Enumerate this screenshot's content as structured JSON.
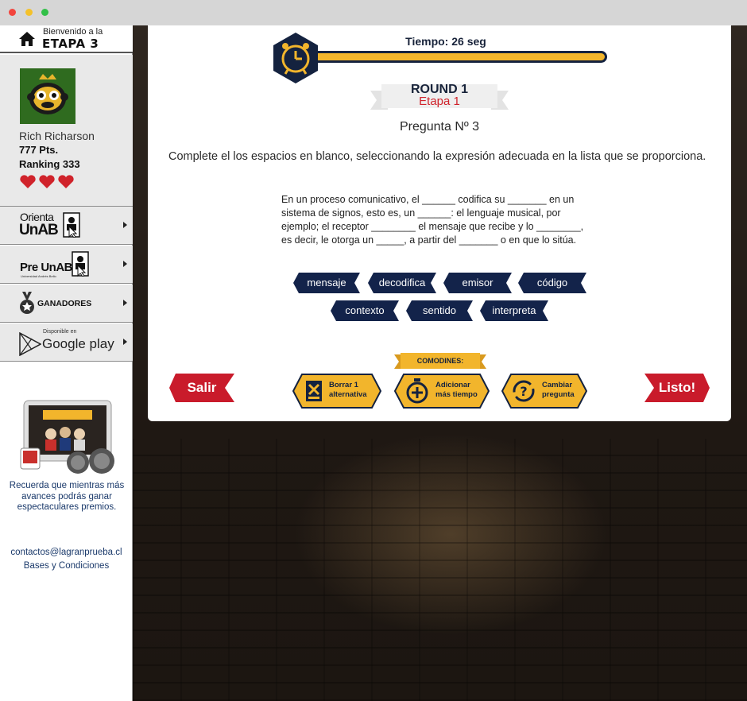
{
  "window": {
    "controls": [
      "close",
      "minimize",
      "maximize"
    ]
  },
  "sidebar": {
    "welcome": "Bienvenido a la",
    "stage_title": "ETAPA 3",
    "user": {
      "name": "Rich Richarson",
      "points": "777 Pts.",
      "ranking": "Ranking 333",
      "lives": 3
    },
    "menu": {
      "orienta": {
        "line1": "Orienta",
        "line2": "UnAB"
      },
      "preunab": {
        "line1": "Pre UnAB",
        "small": "Universidad Andrés Bello"
      },
      "ganadores": {
        "label": "GANADORES"
      },
      "googleplay": {
        "small": "Disponible en",
        "label": "Google play"
      }
    },
    "promo_text": "Recuerda que mientras más avances podrás ganar espectaculares premios.",
    "contact_email": "contactos@lagranprueba.cl",
    "terms_link": "Bases y Condiciones"
  },
  "game": {
    "timer_label": "Tiempo: 26 seg",
    "timer_fraction": 1.0,
    "round_label": "ROUND 1",
    "stage_label": "Etapa 1",
    "question_title": "Pregunta Nº 3",
    "instruction": "Complete el los espacios en blanco, seleccionando la expresión adecuada en  la lista que se proporciona.",
    "question_lines": [
      "En un proceso comunicativo, el ______ codifica su _______ en un",
      "sistema de signos, esto es, un ______: el lenguaje musical, por",
      "ejemplo; el receptor ________ el mensaje que recibe y lo ________,",
      "es decir, le otorga un _____,   a partir del _______ o  en que lo sitúa."
    ],
    "options": [
      "mensaje",
      "decodifica",
      "emisor",
      "código",
      "contexto",
      "sentido",
      "interpreta"
    ],
    "comodines_label": "COMODINES:",
    "lifelines": {
      "delete": {
        "line1": "Borrar 1",
        "line2": "alternativa"
      },
      "add_time": {
        "line1": "Adicionar",
        "line2": "más tiempo"
      },
      "change": {
        "line1": "Cambiar",
        "line2": "pregunta"
      }
    },
    "exit_label": "Salir",
    "done_label": "Listo!"
  },
  "colors": {
    "navy": "#14223f",
    "gold": "#f2b52c",
    "red": "#c91b2b",
    "stage_red": "#d0232b"
  }
}
